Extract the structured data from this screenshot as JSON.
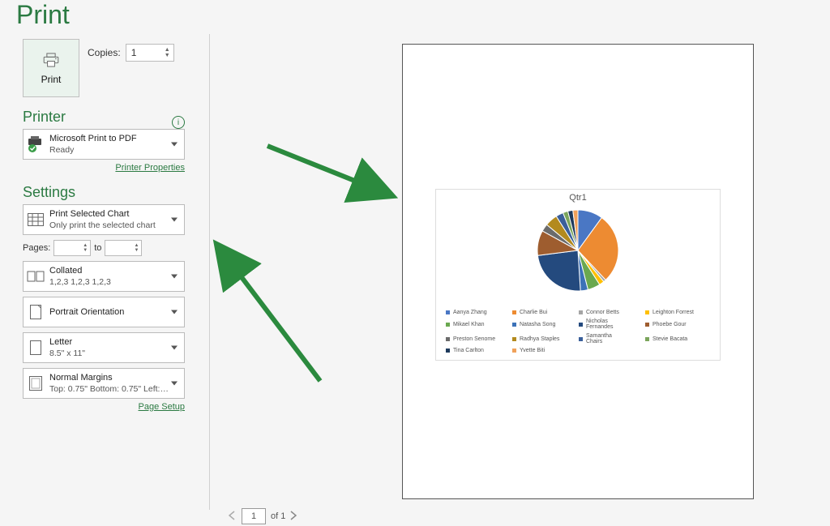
{
  "page_title": "Print",
  "print_button_label": "Print",
  "copies_label": "Copies:",
  "copies_value": "1",
  "printer_heading": "Printer",
  "printer_name": "Microsoft Print to PDF",
  "printer_status": "Ready",
  "printer_properties_link": "Printer Properties",
  "settings_heading": "Settings",
  "setting_what": {
    "line1": "Print Selected Chart",
    "line2": "Only print the selected chart"
  },
  "pages_label": "Pages:",
  "pages_to": "to",
  "setting_collate": {
    "line1": "Collated",
    "line2": "1,2,3    1,2,3    1,2,3"
  },
  "setting_orientation": {
    "line1": "Portrait Orientation"
  },
  "setting_paper": {
    "line1": "Letter",
    "line2": "8.5\" x 11\""
  },
  "setting_margins": {
    "line1": "Normal Margins",
    "line2": "Top: 0.75\" Bottom: 0.75\" Left:…"
  },
  "page_setup_link": "Page Setup",
  "nav": {
    "current": "1",
    "of_label": "of 1"
  },
  "chart_data": {
    "type": "pie",
    "title": "Qtr1",
    "series": [
      {
        "name": "Aanya Zhang",
        "value": 10,
        "color": "#4a77c4"
      },
      {
        "name": "Charlie Bui",
        "value": 28,
        "color": "#ed8b32"
      },
      {
        "name": "Connor Betts",
        "value": 1,
        "color": "#a5a5a5"
      },
      {
        "name": "Leighton Forrest",
        "value": 2,
        "color": "#ffc000"
      },
      {
        "name": "Mikael Khan",
        "value": 5,
        "color": "#6aa84f"
      },
      {
        "name": "Natasha Song",
        "value": 3,
        "color": "#3c72b8"
      },
      {
        "name": "Nicholas Fernandes",
        "value": 24,
        "color": "#244a7e"
      },
      {
        "name": "Phoebe Gour",
        "value": 10,
        "color": "#9e5d2f"
      },
      {
        "name": "Preston Senome",
        "value": 3,
        "color": "#6b6b6b"
      },
      {
        "name": "Radhya Staples",
        "value": 5,
        "color": "#b38a1e"
      },
      {
        "name": "Samantha Chairs",
        "value": 3,
        "color": "#3a5f9a"
      },
      {
        "name": "Stevie Bacata",
        "value": 2,
        "color": "#7ba55b"
      },
      {
        "name": "Tina Carlton",
        "value": 2,
        "color": "#1e3a5c"
      },
      {
        "name": "Yvette Biti",
        "value": 2,
        "color": "#f0a15a"
      }
    ]
  }
}
